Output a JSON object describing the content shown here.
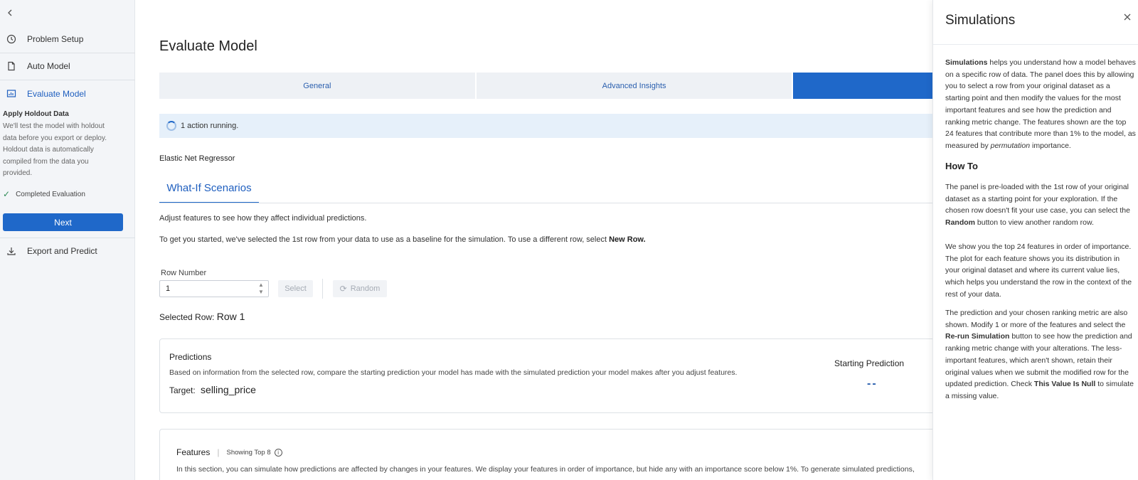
{
  "sidebar": {
    "nav": [
      {
        "label": "Problem Setup",
        "icon": "clock-icon"
      },
      {
        "label": "Auto Model",
        "icon": "document-icon"
      },
      {
        "label": "Evaluate Model",
        "icon": "chart-icon"
      }
    ],
    "holdout": {
      "title": "Apply Holdout Data",
      "description": "We'll test the model with holdout data before you export or deploy. Holdout data is automatically compiled from the data you provided.",
      "status": "Completed Evaluation"
    },
    "next_label": "Next",
    "export_label": "Export and Predict"
  },
  "main": {
    "title": "Evaluate Model",
    "tabs": [
      {
        "label": "General"
      },
      {
        "label": "Advanced Insights"
      },
      {
        "label": ""
      }
    ],
    "banner": "1 action running.",
    "model_name": "Elastic Net Regressor",
    "subtab": "What-If Scenarios",
    "intro1": "Adjust features to see how they affect individual predictions.",
    "intro2_prefix": "To get you started, we've selected the 1st row from your data to use as a baseline for the simulation. To use a different row, select ",
    "intro2_bold": "New Row.",
    "row_number_label": "Row Number",
    "row_number_value": "1",
    "select_label": "Select",
    "random_label": "Random",
    "selected_row_label": "Selected Row:",
    "selected_row_value": "Row 1",
    "predictions": {
      "title": "Predictions",
      "description": "Based on information from the selected row, compare the starting prediction your model has made with the simulated prediction your model makes after you adjust features.",
      "target_label": "Target:",
      "target_value": "selling_price",
      "starting_label": "Starting Prediction",
      "starting_value": "--"
    },
    "features": {
      "title": "Features",
      "showing": "Showing Top 8",
      "description": "In this section, you can simulate how predictions are affected by changes in your features. We display your features in order of importance, but hide any with an importance score below 1%. To generate simulated predictions,"
    }
  },
  "panel": {
    "title": "Simulations",
    "p1_b1": "Simulations",
    "p1_t1": " helps you understand how a model behaves on a specific row of data. The panel does this by allowing you to select a row from your original dataset as a starting point and then modify the values for the most important features and see how the prediction and ranking metric change. The features shown are the top 24 features that contribute more than 1% to the model, as measured by ",
    "p1_i1": "permutation",
    "p1_t2": " importance.",
    "howto": "How To",
    "p2_t1": "The panel is pre-loaded with the 1st row of your original dataset as a starting point for your exploration. If the chosen row doesn't fit your use case, you can select the ",
    "p2_b1": "Random",
    "p2_t2": " button to view another random row.",
    "p3": "We show you the top 24 features in order of importance. The plot for each feature shows you its distribution in your original dataset and where its current value lies, which helps you understand the row in the context of the rest of your data.",
    "p4_t1": "The prediction and your chosen ranking metric are also shown. Modify 1 or more of the features and select the ",
    "p4_b1": "Re-run Simulation",
    "p4_t2": " button to see how the prediction and ranking metric change with your alterations. The less-important features, which aren't shown, retain their original values when we submit the modified row for the updated prediction. Check ",
    "p4_b2": "This Value Is Null",
    "p4_t3": " to simulate a missing value."
  },
  "colors": {
    "accent": "#1f68c9",
    "sidebar_bg": "#f3f5f8",
    "banner_bg": "#e6f0fa",
    "success": "#2e8b57"
  }
}
